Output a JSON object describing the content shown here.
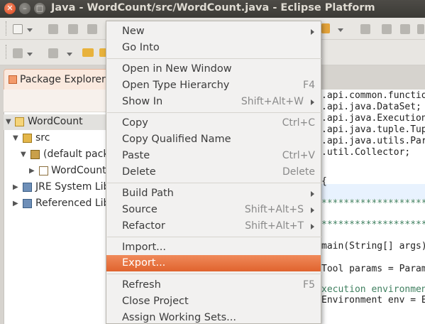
{
  "window": {
    "title": "Java - WordCount/src/WordCount.java - Eclipse Platform",
    "close_glyph": "✕",
    "min_glyph": "–",
    "max_glyph": "□"
  },
  "package_explorer": {
    "tab_label": "Package Explorer",
    "tree": [
      {
        "label": "WordCount",
        "icon": "project-icon",
        "twisty": "▼"
      },
      {
        "label": "src",
        "icon": "source-folder-icon",
        "twisty": "▼"
      },
      {
        "label": "(default pack",
        "icon": "package-icon",
        "twisty": "▼"
      },
      {
        "label": "WordCount",
        "icon": "java-file-icon",
        "twisty": "▶"
      },
      {
        "label": "JRE System Lib",
        "icon": "library-icon",
        "twisty": "▶"
      },
      {
        "label": "Referenced Lib",
        "icon": "library-icon",
        "twisty": "▶"
      }
    ]
  },
  "editor": {
    "lines": [
      ".api.common.function",
      ".api.java.DataSet;",
      ".api.java.Execution",
      ".api.java.tuple.Tup",
      ".api.java.utils.Par",
      ".util.Collector;",
      "",
      "{",
      "",
      "**********************",
      "",
      "**********************",
      "",
      "main(String[] args)",
      "",
      "Tool params = Param",
      "",
      "xecution environmen",
      "Environment env = E"
    ]
  },
  "context_menu": {
    "items": [
      {
        "label": "New",
        "accel": "",
        "submenu": true,
        "mnemonic": "w"
      },
      {
        "label": "Go Into",
        "accel": "",
        "submenu": false
      },
      {
        "sep": true
      },
      {
        "label": "Open in New Window",
        "accel": "",
        "submenu": false
      },
      {
        "label": "Open Type Hierarchy",
        "accel": "F4",
        "submenu": false
      },
      {
        "label": "Show In",
        "accel": "Shift+Alt+W",
        "submenu": true
      },
      {
        "sep": true
      },
      {
        "label": "Copy",
        "accel": "Ctrl+C",
        "submenu": false
      },
      {
        "label": "Copy Qualified Name",
        "accel": "",
        "submenu": false
      },
      {
        "label": "Paste",
        "accel": "Ctrl+V",
        "submenu": false
      },
      {
        "label": "Delete",
        "accel": "Delete",
        "submenu": false
      },
      {
        "sep": true
      },
      {
        "label": "Build Path",
        "accel": "",
        "submenu": true
      },
      {
        "label": "Source",
        "accel": "Shift+Alt+S",
        "submenu": true
      },
      {
        "label": "Refactor",
        "accel": "Shift+Alt+T",
        "submenu": true
      },
      {
        "sep": true
      },
      {
        "label": "Import...",
        "accel": "",
        "submenu": false
      },
      {
        "label": "Export...",
        "accel": "",
        "submenu": false,
        "highlighted": true
      },
      {
        "sep": true
      },
      {
        "label": "Refresh",
        "accel": "F5",
        "submenu": false
      },
      {
        "label": "Close Project",
        "accel": "",
        "submenu": false
      },
      {
        "label": "Assign Working Sets...",
        "accel": "",
        "submenu": false
      }
    ]
  },
  "colors": {
    "highlight": "#e56f3c",
    "titlebar": "#3c3b37",
    "menu_bg": "#f2f1f0"
  }
}
